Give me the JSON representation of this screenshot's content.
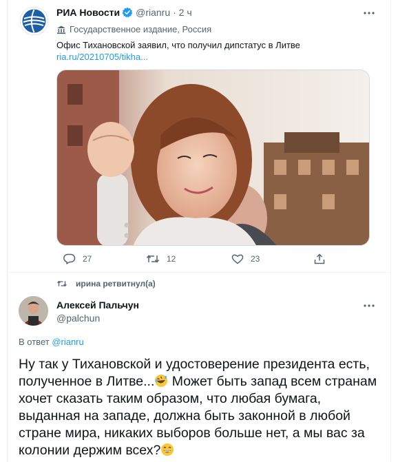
{
  "tweet": {
    "author_name": "РИА Новости",
    "author_handle": "@rianru",
    "time": "· 2 ч",
    "state_label": "Государственное издание, Россия",
    "text": "Офис Тихановской заявил, что получил дипстатус в Литве",
    "link": "ria.ru/20210705/tikha...",
    "replies": "27",
    "retweets": "12",
    "likes": "23"
  },
  "retweet_header": "ирина ретвитнул(а)",
  "reply_tweet": {
    "author_name": "Алексей Пальчун",
    "author_handle": "@palchun",
    "reply_prefix": "В ответ ",
    "reply_to": "@rianru",
    "text_part1": "Ну так у Тихановской и удостоверение президента есть, полученное в Литве...",
    "text_part2": " Может быть запад всем странам хочет сказать таким образом, что любая бумага, выданная на западе, должна быть законной в любой стране мира, никаких выборов больше нет, а мы вас за колонии держим всех?"
  },
  "colors": {
    "accent": "#1d9bf0",
    "secondary_text": "#536471",
    "ria_brand": "#1d5ea8"
  },
  "icons": [
    "verified-badge-icon",
    "more-icon",
    "state-media-icon",
    "reply-icon",
    "retweet-icon",
    "like-icon",
    "share-icon",
    "rofl-emoji-icon",
    "grin-emoji-icon"
  ]
}
